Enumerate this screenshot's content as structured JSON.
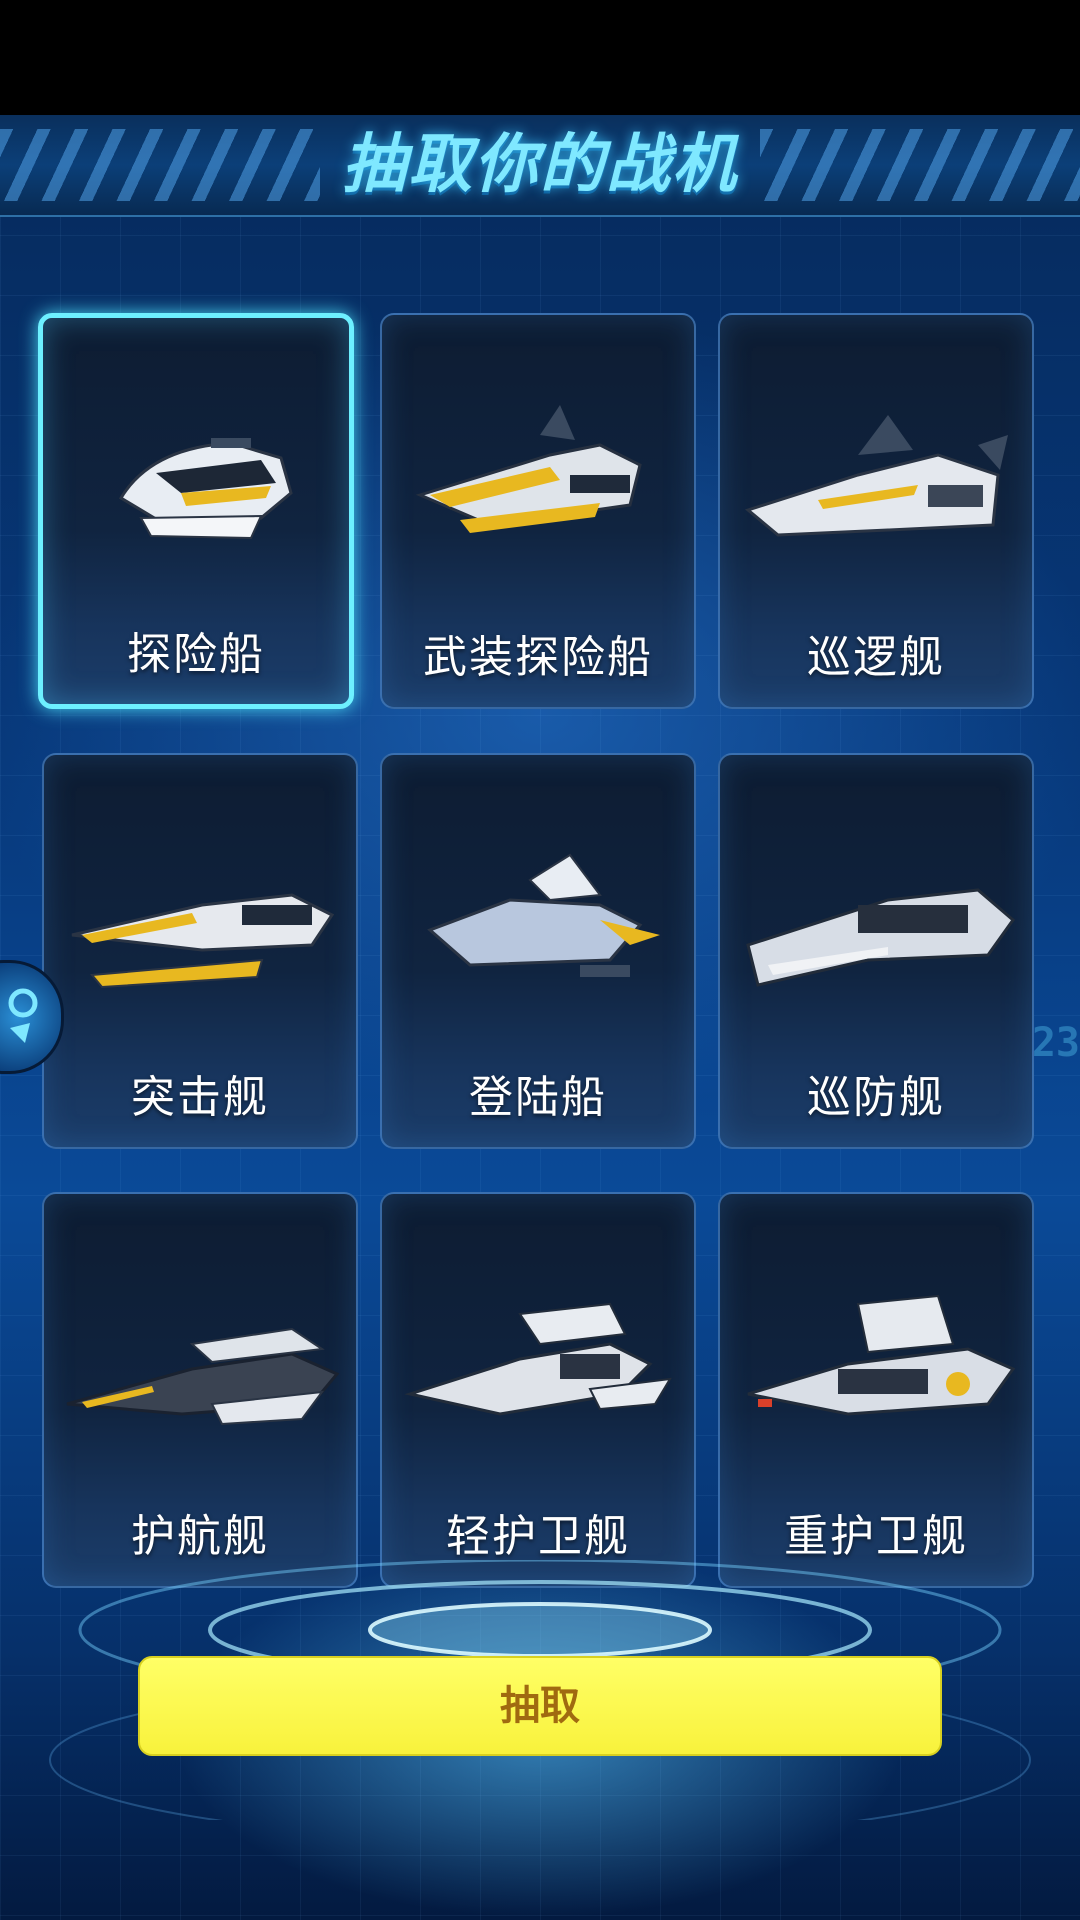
{
  "header": {
    "title": "抽取你的战机"
  },
  "ships": [
    {
      "name": "探险船",
      "selected": true,
      "icon": "explorer-ship-icon"
    },
    {
      "name": "武装探险船",
      "selected": false,
      "icon": "armed-explorer-ship-icon"
    },
    {
      "name": "巡逻舰",
      "selected": false,
      "icon": "patrol-ship-icon"
    },
    {
      "name": "突击舰",
      "selected": false,
      "icon": "assault-ship-icon"
    },
    {
      "name": "登陆船",
      "selected": false,
      "icon": "landing-ship-icon"
    },
    {
      "name": "巡防舰",
      "selected": false,
      "icon": "frigate-ship-icon"
    },
    {
      "name": "护航舰",
      "selected": false,
      "icon": "escort-ship-icon"
    },
    {
      "name": "轻护卫舰",
      "selected": false,
      "icon": "light-corvette-ship-icon"
    },
    {
      "name": "重护卫舰",
      "selected": false,
      "icon": "heavy-corvette-ship-icon"
    }
  ],
  "action": {
    "draw_label": "抽取"
  },
  "side_text": "23",
  "colors": {
    "accent": "#6df0ff",
    "button": "#f8f23c",
    "button_text": "#a06a10",
    "ship_yellow": "#e8b820"
  }
}
